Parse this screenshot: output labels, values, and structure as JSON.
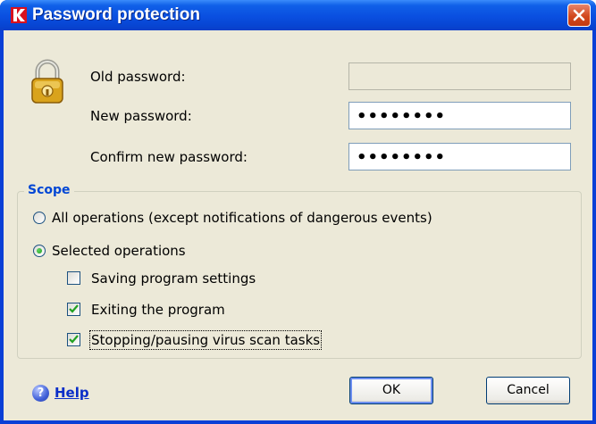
{
  "window": {
    "title": "Password protection",
    "icon": "kaspersky-k-icon",
    "close_label": "Close"
  },
  "form": {
    "old_password_label": "Old password:",
    "old_password_value": "",
    "new_password_label": "New password:",
    "new_password_value": "••••••••",
    "confirm_password_label": "Confirm new password:",
    "confirm_password_value": "••••••••"
  },
  "scope": {
    "title": "Scope",
    "options": [
      {
        "label": "All operations (except notifications of dangerous events)",
        "selected": false
      },
      {
        "label": "Selected operations",
        "selected": true
      }
    ],
    "checks": [
      {
        "label": "Saving program settings",
        "checked": false
      },
      {
        "label": "Exiting the program",
        "checked": true
      },
      {
        "label": "Stopping/pausing virus scan tasks",
        "checked": true
      }
    ]
  },
  "footer": {
    "help_label": "Help",
    "ok_label": "OK",
    "cancel_label": "Cancel"
  },
  "colors": {
    "title_bar": "#0a4fe0",
    "dialog_bg": "#ece9d8",
    "group_title": "#0046d5",
    "link": "#0a2ec8",
    "close_button": "#d2481e"
  }
}
